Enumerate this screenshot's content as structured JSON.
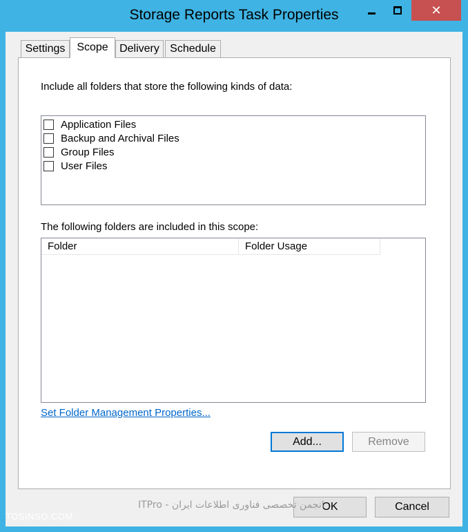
{
  "window": {
    "title": "Storage Reports Task Properties",
    "minimize_icon": "minimize-icon",
    "maximize_icon": "maximize-icon",
    "close_icon": "close-icon",
    "close_glyph": "✕",
    "accent_color": "#3fb3e3",
    "close_color": "#c75050"
  },
  "tabs": [
    {
      "label": "Settings"
    },
    {
      "label": "Scope"
    },
    {
      "label": "Delivery"
    },
    {
      "label": "Schedule"
    }
  ],
  "scope": {
    "kinds_label": "Include all folders that store the following kinds of data:",
    "kinds": [
      {
        "label": "Application Files",
        "checked": false
      },
      {
        "label": "Backup and Archival Files",
        "checked": false
      },
      {
        "label": "Group Files",
        "checked": false
      },
      {
        "label": "User Files",
        "checked": false
      }
    ],
    "folders_label": "The following folders are included in this scope:",
    "columns": [
      "Folder",
      "Folder Usage"
    ],
    "folders": [],
    "link": "Set Folder Management Properties...",
    "add_label": "Add...",
    "remove_label": "Remove"
  },
  "footer": {
    "ok_label": "OK",
    "cancel_label": "Cancel"
  },
  "watermark": {
    "left": "TOSINSO.COM",
    "center": "ITPro - انجمن تخصصی فناوری اطلاعات ایران"
  }
}
